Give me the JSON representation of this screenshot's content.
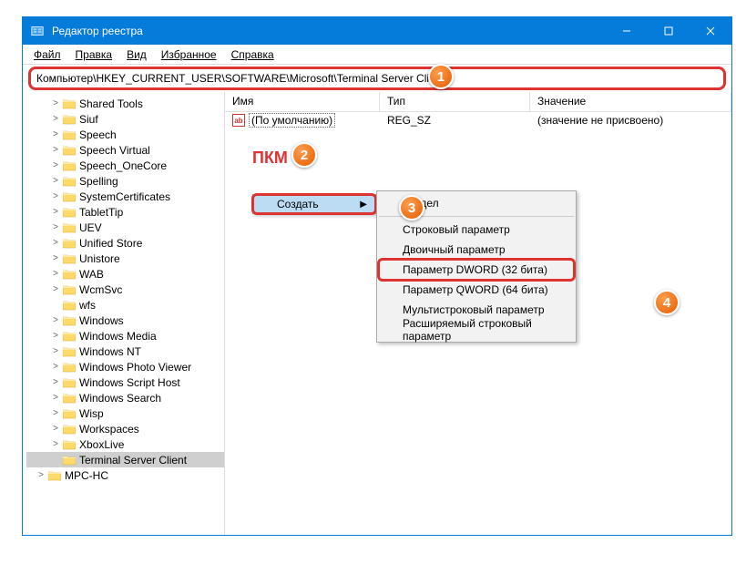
{
  "title": "Редактор реестра",
  "menu": {
    "file": "Файл",
    "edit": "Правка",
    "view": "Вид",
    "fav": "Избранное",
    "help": "Справка"
  },
  "address": "Компьютер\\HKEY_CURRENT_USER\\SOFTWARE\\Microsoft\\Terminal Server Client",
  "columns": {
    "name": "Имя",
    "type": "Тип",
    "value": "Значение"
  },
  "default_row": {
    "name": "(По умолчанию)",
    "type": "REG_SZ",
    "value": "(значение не присвоено)"
  },
  "pkm": "ПКМ",
  "ctx_create": "Создать",
  "sub": {
    "section": "Раздел",
    "string": "Строковый параметр",
    "binary": "Двоичный параметр",
    "dword": "Параметр DWORD (32 бита)",
    "qword": "Параметр QWORD (64 бита)",
    "multi": "Мультистроковый параметр",
    "expand": "Расширяемый строковый параметр"
  },
  "steps": {
    "s1": "1",
    "s2": "2",
    "s3": "3",
    "s4": "4"
  },
  "tree": [
    {
      "l": "Shared Tools",
      "e": ">"
    },
    {
      "l": "Siuf",
      "e": ">"
    },
    {
      "l": "Speech",
      "e": ">"
    },
    {
      "l": "Speech Virtual",
      "e": ">"
    },
    {
      "l": "Speech_OneCore",
      "e": ">"
    },
    {
      "l": "Spelling",
      "e": ">"
    },
    {
      "l": "SystemCertificates",
      "e": ">"
    },
    {
      "l": "TabletTip",
      "e": ">"
    },
    {
      "l": "UEV",
      "e": ">"
    },
    {
      "l": "Unified Store",
      "e": ">"
    },
    {
      "l": "Unistore",
      "e": ">"
    },
    {
      "l": "WAB",
      "e": ">"
    },
    {
      "l": "WcmSvc",
      "e": ">"
    },
    {
      "l": "wfs",
      "e": ""
    },
    {
      "l": "Windows",
      "e": ">"
    },
    {
      "l": "Windows Media",
      "e": ">"
    },
    {
      "l": "Windows NT",
      "e": ">"
    },
    {
      "l": "Windows Photo Viewer",
      "e": ">"
    },
    {
      "l": "Windows Script Host",
      "e": ">"
    },
    {
      "l": "Windows Search",
      "e": ">"
    },
    {
      "l": "Wisp",
      "e": ">"
    },
    {
      "l": "Workspaces",
      "e": ">"
    },
    {
      "l": "XboxLive",
      "e": ">"
    },
    {
      "l": "Terminal Server Client",
      "e": "",
      "sel": true
    }
  ],
  "tree_tail": {
    "l": "MPC-HC",
    "e": ">"
  }
}
